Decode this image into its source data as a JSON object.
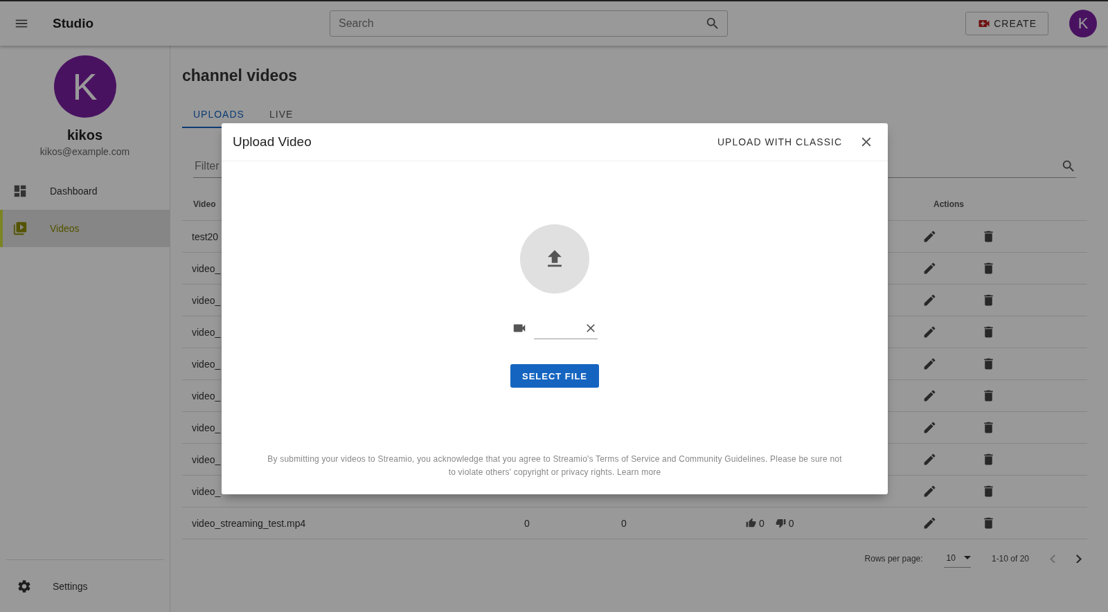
{
  "topbar": {
    "title": "Studio",
    "search": {
      "placeholder": "Search"
    },
    "create_button": "CREATE",
    "avatar": "K"
  },
  "sidebar": {
    "profile": {
      "avatar": "K",
      "name": "kikos",
      "email": "kikos@example.com"
    },
    "items": [
      {
        "kind": "dashboard",
        "label": "Dashboard",
        "selected": false
      },
      {
        "kind": "videos",
        "label": "Videos",
        "selected": true
      }
    ],
    "footer": {
      "kind": "settings",
      "label": "Settings"
    }
  },
  "main": {
    "title": "channel videos",
    "tabs": [
      {
        "label": "UPLOADS",
        "selected": true
      },
      {
        "label": "LIVE",
        "selected": false
      }
    ],
    "filter": {
      "placeholder": "Filter"
    },
    "table": {
      "columns": {
        "video": "Video",
        "actions": "Actions"
      },
      "rows": [
        {
          "video": "test20"
        },
        {
          "video": "video_"
        },
        {
          "video": "video_"
        },
        {
          "video": "video_"
        },
        {
          "video": "video_"
        },
        {
          "video": "video_"
        },
        {
          "video": "video_"
        },
        {
          "video": "video_"
        },
        {
          "video": "video_"
        },
        {
          "video": "video_streaming_test.mp4",
          "column_2": "0",
          "column_3": "0",
          "likes": "0",
          "dislikes": "0"
        }
      ]
    },
    "pagination": {
      "rows_per_page_label": "Rows per page:",
      "rows_per_page": "10",
      "range": "1-10 of 20"
    }
  },
  "modal": {
    "title": "Upload Video",
    "classic_button": "UPLOAD WITH CLASSIC",
    "select_button": "SELECT FILE",
    "disclaimer": {
      "text": "By submitting your videos to Streamio, you acknowledge that you agree to Streamio's Terms of Service and Community Guidelines. Please be sure not to violate others' copyright or privacy rights.",
      "link": "Learn more"
    }
  }
}
